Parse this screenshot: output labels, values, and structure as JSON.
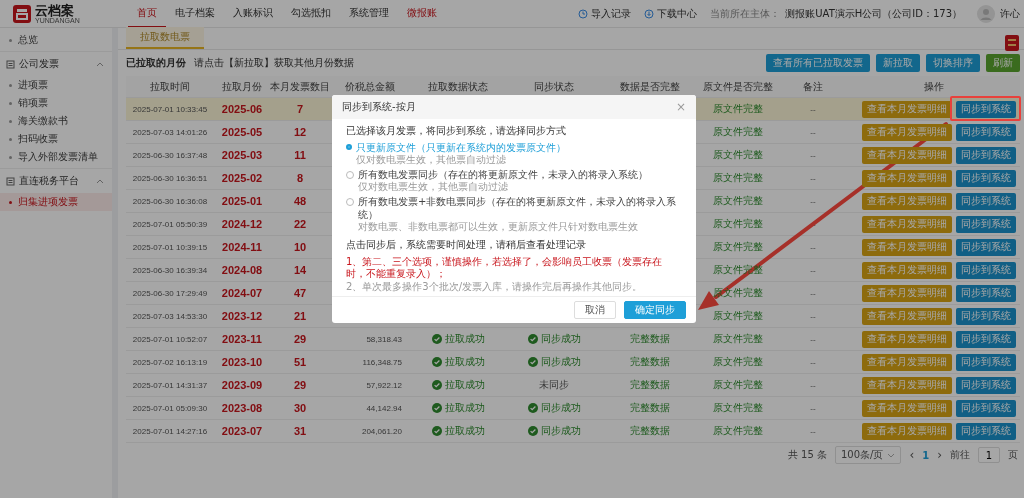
{
  "header": {
    "logo_text": "云档案",
    "logo_sub": "YUNDANGAN",
    "nav": [
      {
        "label": "首页",
        "selected": true,
        "accent": false
      },
      {
        "label": "电子档案",
        "selected": false,
        "accent": false
      },
      {
        "label": "入账标识",
        "selected": false,
        "accent": false
      },
      {
        "label": "勾选抵扣",
        "selected": false,
        "accent": false
      },
      {
        "label": "系统管理",
        "selected": false,
        "accent": false
      },
      {
        "label": "微报账",
        "selected": false,
        "accent": true
      }
    ],
    "links": [
      "导入记录",
      "下载中心"
    ],
    "entity_label": "当前所在主体：",
    "entity": "测报账UAT演示H公司（公司ID：173）",
    "user": "许心"
  },
  "sidebar": {
    "items": [
      {
        "label": "总览",
        "selected": false
      },
      {
        "label": "公司发票",
        "selected": false,
        "expanded": true,
        "children": [
          {
            "label": "进项票",
            "selected": false
          },
          {
            "label": "销项票",
            "selected": false
          },
          {
            "label": "海关缴款书",
            "selected": false
          },
          {
            "label": "扫码收票",
            "selected": false
          },
          {
            "label": "导入外部发票清单",
            "selected": false
          }
        ]
      },
      {
        "label": "直连税务平台",
        "selected": false,
        "expanded": true,
        "children": [
          {
            "label": "归集进项发票",
            "selected": true
          }
        ]
      }
    ]
  },
  "tabs": [
    {
      "label": "拉取数电票",
      "selected": true
    }
  ],
  "toolbar": {
    "title": "已拉取的月份",
    "hint": "请点击【新拉取】获取其他月份数据",
    "buttons": [
      {
        "label": "查看所有已拉取发票",
        "kind": "info"
      },
      {
        "label": "新拉取",
        "kind": "info"
      },
      {
        "label": "切换排序",
        "kind": "info"
      },
      {
        "label": "刷新",
        "kind": "success"
      }
    ]
  },
  "table": {
    "columns": [
      "拉取时间",
      "拉取月份",
      "本月发票数目",
      "价税总金额",
      "拉取数据状态",
      "同步状态",
      "数据是否完整",
      "原文件是否完整",
      "备注",
      "操作"
    ],
    "rows": [
      {
        "selected": true,
        "time": "2025-07-01 10:33:45",
        "month": "2025-06",
        "count": "7",
        "file_status": "原文件完整",
        "remark": "--",
        "actions": [
          "查看本月发票明细",
          "同步到系统"
        ]
      },
      {
        "selected": false,
        "time": "2025-07-03 14:01:26",
        "month": "2025-05",
        "count": "12",
        "file_status": "原文件完整",
        "remark": "--",
        "actions": [
          "查看本月发票明细",
          "同步到系统"
        ]
      },
      {
        "selected": false,
        "time": "2025-06-30 16:37:48",
        "month": "2025-03",
        "count": "11",
        "file_status": "原文件完整",
        "remark": "--",
        "actions": [
          "查看本月发票明细",
          "同步到系统"
        ]
      },
      {
        "selected": false,
        "time": "2025-06-30 16:36:51",
        "month": "2025-02",
        "count": "8",
        "file_status": "原文件完整",
        "remark": "--",
        "actions": [
          "查看本月发票明细",
          "同步到系统"
        ]
      },
      {
        "selected": false,
        "time": "2025-06-30 16:36:08",
        "month": "2025-01",
        "count": "48",
        "file_status": "原文件完整",
        "remark": "--",
        "actions": [
          "查看本月发票明细",
          "同步到系统"
        ]
      },
      {
        "selected": false,
        "time": "2025-07-01 05:50:39",
        "month": "2024-12",
        "count": "22",
        "file_status": "原文件完整",
        "remark": "--",
        "actions": [
          "查看本月发票明细",
          "同步到系统"
        ]
      },
      {
        "selected": false,
        "time": "2025-07-01 10:39:15",
        "month": "2024-11",
        "count": "10",
        "file_status": "原文件完整",
        "remark": "--",
        "actions": [
          "查看本月发票明细",
          "同步到系统"
        ]
      },
      {
        "selected": false,
        "time": "2025-06-30 16:39:34",
        "month": "2024-08",
        "count": "14",
        "file_status": "原文件完整",
        "remark": "--",
        "actions": [
          "查看本月发票明细",
          "同步到系统"
        ]
      },
      {
        "selected": false,
        "time": "2025-06-30 17:29:49",
        "month": "2024-07",
        "count": "47",
        "file_status": "原文件完整",
        "remark": "--",
        "actions": [
          "查看本月发票明细",
          "同步到系统"
        ]
      },
      {
        "selected": false,
        "time": "2025-07-03 14:53:30",
        "month": "2023-12",
        "count": "21",
        "file_status": "原文件完整",
        "remark": "--",
        "actions": [
          "查看本月发票明细",
          "同步到系统"
        ]
      },
      {
        "selected": false,
        "time": "2025-07-01 10:52:07",
        "month": "2023-11",
        "count": "29",
        "amount": "58,318.43",
        "pull_status": {
          "text": "拉取成功",
          "ok": true
        },
        "sync_status": {
          "text": "同步成功",
          "ok": true
        },
        "data_status": "完整数据",
        "file_status": "原文件完整",
        "remark": "--",
        "actions": [
          "查看本月发票明细",
          "同步到系统"
        ]
      },
      {
        "selected": false,
        "time": "2025-07-02 16:13:19",
        "month": "2023-10",
        "count": "51",
        "amount": "116,348.75",
        "pull_status": {
          "text": "拉取成功",
          "ok": true
        },
        "sync_status": {
          "text": "同步成功",
          "ok": true
        },
        "data_status": "完整数据",
        "file_status": "原文件完整",
        "remark": "--",
        "actions": [
          "查看本月发票明细",
          "同步到系统"
        ]
      },
      {
        "selected": false,
        "time": "2025-07-01 14:31:37",
        "month": "2023-09",
        "count": "29",
        "amount": "57,922.12",
        "pull_status": {
          "text": "拉取成功",
          "ok": true
        },
        "sync_status": {
          "text": "未同步",
          "ok": false
        },
        "data_status": "完整数据",
        "file_status": "原文件完整",
        "remark": "--",
        "actions": [
          "查看本月发票明细",
          "同步到系统"
        ]
      },
      {
        "selected": false,
        "time": "2025-07-01 05:09:30",
        "month": "2023-08",
        "count": "30",
        "amount": "44,142.94",
        "pull_status": {
          "text": "拉取成功",
          "ok": true
        },
        "sync_status": {
          "text": "同步成功",
          "ok": true
        },
        "data_status": "完整数据",
        "file_status": "原文件完整",
        "remark": "--",
        "actions": [
          "查看本月发票明细",
          "同步到系统"
        ]
      },
      {
        "selected": false,
        "time": "2025-07-01 14:27:16",
        "month": "2023-07",
        "count": "31",
        "amount": "204,061.20",
        "pull_status": {
          "text": "拉取成功",
          "ok": true
        },
        "sync_status": {
          "text": "同步成功",
          "ok": true
        },
        "data_status": "完整数据",
        "file_status": "原文件完整",
        "remark": "--",
        "actions": [
          "查看本月发票明细",
          "同步到系统"
        ]
      }
    ]
  },
  "pagination": {
    "total": "共 15 条",
    "page_size": "100条/页",
    "prev": "‹",
    "pages": [
      {
        "label": "1",
        "selected": true
      }
    ],
    "next": "›",
    "goto_label": "前往",
    "goto_value": "1",
    "goto_suffix": "页"
  },
  "dialog": {
    "title": "同步到系统-按月",
    "close": "×",
    "intro": "已选择该月发票，将同步到系统，请选择同步方式",
    "options": [
      {
        "label": "只更新原文件（只更新在系统内的发票原文件）",
        "note": "仅对数电票生效，其他票自动过滤",
        "selected": true
      },
      {
        "label": "所有数电发票同步（存在的将更新原文件，未录入的将录入系统）",
        "note": "仅对数电票生效，其他票自动过滤",
        "selected": false
      },
      {
        "label": "所有数电发票+非数电票同步（存在的将更新原文件，未录入的将录入系统）",
        "note": "对数电票、非数电票都可以生效，更新原文件只针对数电票生效",
        "selected": false
      }
    ],
    "info": "点击同步后，系统需要时间处理，请稍后查看处理记录",
    "notes": [
      {
        "text": "1、第二、三个选项，谨慎操作，若选择了，会影响员工收票（发票存在时，不能重复录入）；",
        "kind": "warning"
      },
      {
        "text": "2、单次最多操作3个批次/发票入库，请操作完后再操作其他同步。",
        "kind": "plain"
      }
    ],
    "buttons": [
      {
        "label": "取消",
        "kind": "default"
      },
      {
        "label": "确定同步",
        "kind": "primary"
      }
    ]
  }
}
